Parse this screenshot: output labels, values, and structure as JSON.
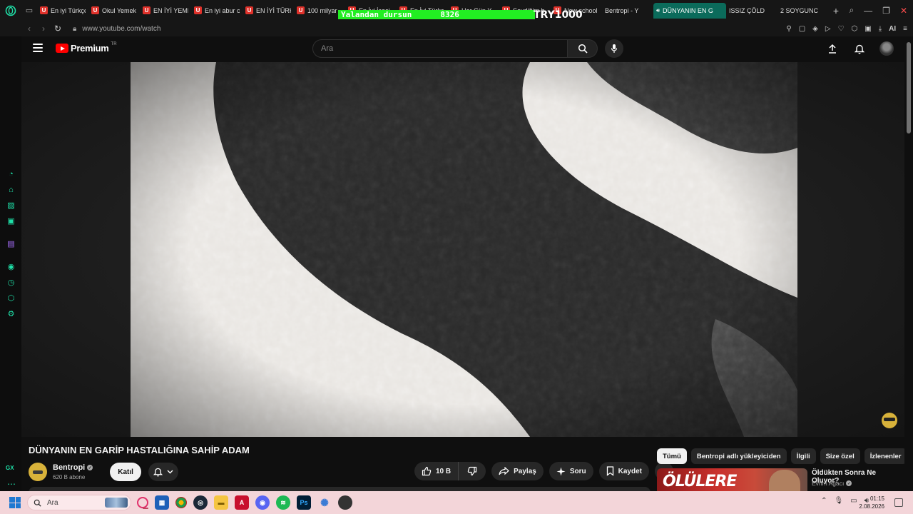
{
  "browser": {
    "tabs": [
      {
        "title": "En iyi Türkçe",
        "favicon": "u-red"
      },
      {
        "title": "Okul Yemek",
        "favicon": "u-red"
      },
      {
        "title": "EN İYİ YEME",
        "favicon": "u-red"
      },
      {
        "title": "En iyi abur c",
        "favicon": "u-red"
      },
      {
        "title": "EN İYİ TÜRK",
        "favicon": "u-red"
      },
      {
        "title": "100 milyar",
        "favicon": "u-red"
      },
      {
        "title": "En İyi İçeci",
        "favicon": "u-red"
      },
      {
        "title": "En İyi Türkç",
        "favicon": "u-red"
      },
      {
        "title": "Her Gün Y",
        "favicon": "u-red"
      },
      {
        "title": "Sevdiğim b",
        "favicon": "u-red"
      },
      {
        "title": "New school",
        "favicon": "u-red"
      },
      {
        "title": "Bentropi - Y",
        "favicon": "youtube"
      },
      {
        "title": "DÜNYANIN EN G",
        "favicon": "youtube",
        "active": true,
        "audio": true
      },
      {
        "title": "ISSIZ ÇÖLD",
        "favicon": "youtube"
      },
      {
        "title": "2 SOYGUNC",
        "favicon": "youtube"
      }
    ],
    "url": "www.youtube.com/watch",
    "overlay": {
      "text": "Yalandan dursun",
      "count": "8326",
      "amount": "TRY1000",
      "color": "#22ee22"
    },
    "ai_label": "AI"
  },
  "youtube": {
    "logo_text": "Premium",
    "region": "TR",
    "search_placeholder": "Ara",
    "video_title": "DÜNYANIN EN GARİP HASTALIĞINA SAHİP ADAM",
    "channel": {
      "name": "Bentropi",
      "subscribers": "620 B abone"
    },
    "join_label": "Katıl",
    "actions": {
      "like_count": "10 B",
      "share": "Paylaş",
      "ask": "Soru",
      "save": "Kaydet"
    },
    "chips": [
      "Tümü",
      "Bentropi adlı yükleyiciden",
      "İlgili",
      "Size özel",
      "İzlenenler"
    ],
    "recommended": {
      "thumb_text": "ÖLÜLERE",
      "title": "Öldükten Sonra Ne Oluyor?",
      "channel": "Evrim Ağacı"
    }
  },
  "gx_sidebar": {
    "label": "GX",
    "icons": [
      "speed-dial-icon",
      "aria-icon",
      "gx-corner-icon",
      "messenger-icon",
      "twitch-icon",
      "player-icon",
      "history-icon",
      "extensions-icon",
      "settings-icon"
    ]
  },
  "taskbar": {
    "search_placeholder": "Ara",
    "time": "01:15",
    "date": "2.08.2026",
    "apps": [
      "opera-gx",
      "taskview",
      "browser-gx",
      "steam",
      "file-explorer",
      "acrobat",
      "discord",
      "spotify",
      "photoshop",
      "network",
      "sticky-app"
    ]
  },
  "colors": {
    "accent_gx": "#1fe0a8",
    "youtube_red": "#ff0000",
    "taskbar_bg": "#f3d5d9"
  }
}
